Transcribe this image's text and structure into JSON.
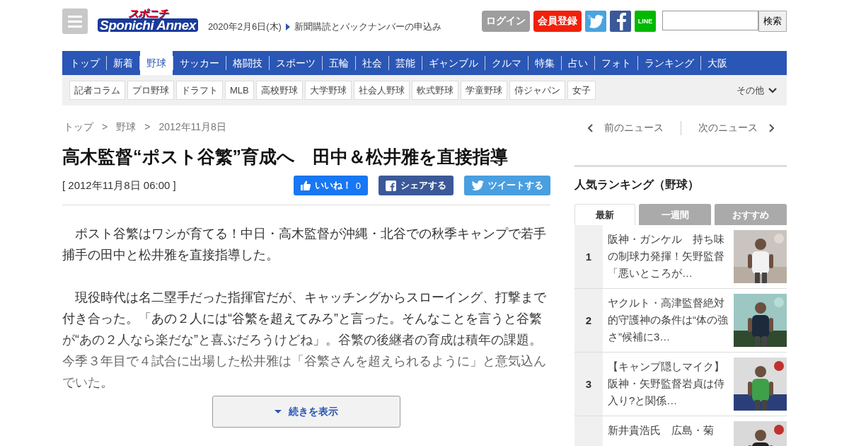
{
  "header": {
    "logo": {
      "top": "スポニチ",
      "bottom": "Sponichi Annex"
    },
    "date": "2020年2月6日(木)",
    "subscribe_link": "新聞購読とバックナンバーの申込み",
    "login": "ログイン",
    "register": "会員登録",
    "line_label": "LINE",
    "search": {
      "button": "検索"
    }
  },
  "nav": [
    {
      "label": "トップ",
      "selected": false
    },
    {
      "label": "新着",
      "selected": false
    },
    {
      "label": "野球",
      "selected": true
    },
    {
      "label": "サッカー",
      "selected": false
    },
    {
      "label": "格闘技",
      "selected": false
    },
    {
      "label": "スポーツ",
      "selected": false
    },
    {
      "label": "五輪",
      "selected": false
    },
    {
      "label": "社会",
      "selected": false
    },
    {
      "label": "芸能",
      "selected": false
    },
    {
      "label": "ギャンブル",
      "selected": false
    },
    {
      "label": "クルマ",
      "selected": false
    },
    {
      "label": "特集",
      "selected": false
    },
    {
      "label": "占い",
      "selected": false
    },
    {
      "label": "フォト",
      "selected": false
    },
    {
      "label": "ランキング",
      "selected": false
    },
    {
      "label": "大阪",
      "selected": false
    }
  ],
  "subnav": {
    "items": [
      "記者コラム",
      "プロ野球",
      "ドラフト",
      "MLB",
      "高校野球",
      "大学野球",
      "社会人野球",
      "軟式野球",
      "学童野球",
      "侍ジャパン",
      "女子"
    ],
    "more": "その他"
  },
  "breadcrumb": {
    "items": [
      "トップ",
      "野球",
      "2012年11月8日"
    ],
    "separators": [
      ">",
      ">"
    ]
  },
  "article": {
    "title": "高木監督“ポスト谷繁”育成へ　田中＆松井雅を直接指導",
    "timestamp": "[ 2012年11月8日 06:00 ]",
    "like": {
      "label": "いいね！",
      "count": "0"
    },
    "share": "シェアする",
    "tweet": "ツイートする",
    "paragraphs": [
      "ポスト谷繁はワシが育てる！中日・高木監督が沖縄・北谷での秋季キャンプで若手捕手の田中と松井雅を直接指導した。",
      "現役時代は名二塁手だった指揮官だが、キャッチングからスローイング、打撃まで付き合った。「あの２人には“谷繁を超えてみろ”と言った。そんなことを言うと谷繁が“あの２人なら楽だな”と喜ぶだろうけどね」。谷繁の後継者の育成は積年の課題。今季３年目で４試合に出場した松井雅は「谷繁さんを超えられるように」と意気込んでいた。"
    ],
    "more_button": "続きを表示"
  },
  "sidebar": {
    "prev": "前のニュース",
    "next": "次のニュース",
    "ranking": {
      "title": "人気ランキング（野球）",
      "tabs": [
        {
          "label": "最新",
          "selected": true
        },
        {
          "label": "一週間",
          "selected": false
        },
        {
          "label": "おすすめ",
          "selected": false
        }
      ],
      "items": [
        {
          "rank": "1",
          "headline": "阪神・ガンケル　持ち味の制球力発揮！矢野監督「悪いところが…"
        },
        {
          "rank": "2",
          "headline": "ヤクルト・高津監督絶対的守護神の条件は“体の強さ”候補に3…"
        },
        {
          "rank": "3",
          "headline": "【キャンプ隠しマイク】阪神・矢野監督岩貞は侍入り?と関係…"
        },
        {
          "headline": "新井貴浩氏　広島・菊"
        }
      ]
    }
  }
}
